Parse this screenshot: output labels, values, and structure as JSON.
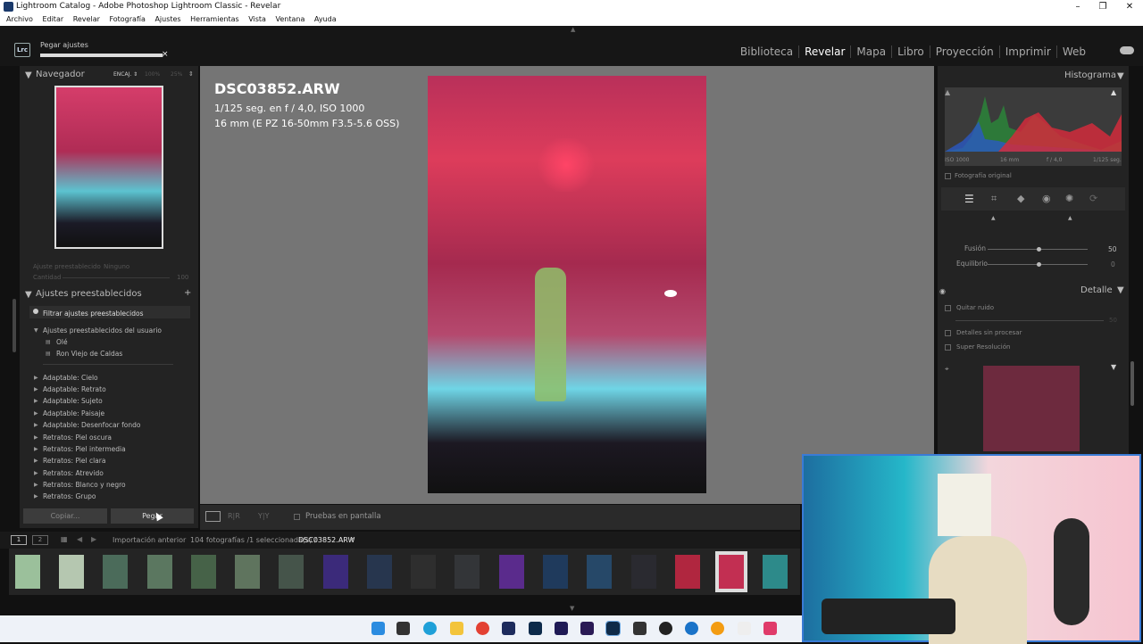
{
  "window": {
    "title": "Lightroom Catalog - Adobe Photoshop Lightroom Classic - Revelar",
    "minimize": "–",
    "maximize": "❐",
    "close": "✕"
  },
  "menu": [
    "Archivo",
    "Editar",
    "Revelar",
    "Fotografía",
    "Ajustes",
    "Herramientas",
    "Vista",
    "Ventana",
    "Ayuda"
  ],
  "topbar": {
    "logo": "Lrc",
    "operation": "Pegar ajustes",
    "progress": 0.99,
    "cancel": "×"
  },
  "modules": [
    "Biblioteca",
    "Revelar",
    "Mapa",
    "Libro",
    "Proyección",
    "Imprimir",
    "Web"
  ],
  "active_module": "Revelar",
  "navigator": {
    "title": "Navegador",
    "zoom_fit": "ENCAJ. ⇕",
    "zoom_100": "100%",
    "zoom_25": "25%"
  },
  "preset_amount": {
    "label": "Ajuste preestablecido",
    "value": "Ninguno",
    "amount_label": "Cantidad",
    "amount_value": "100"
  },
  "presets": {
    "title": "Ajustes preestablecidos",
    "add": "+",
    "filter": "Filtrar ajustes preestablecidos",
    "user_group": "Ajustes preestablecidos del usuario",
    "user_items": [
      "Olé",
      "Ron Viejo de Caldas"
    ],
    "groups": [
      "Adaptable: Cielo",
      "Adaptable: Retrato",
      "Adaptable: Sujeto",
      "Adaptable: Paisaje",
      "Adaptable: Desenfocar fondo",
      "Retratos: Piel oscura",
      "Retratos: Piel intermedia",
      "Retratos: Piel clara",
      "Retratos: Atrevido",
      "Retratos: Blanco y negro",
      "Retratos: Grupo"
    ]
  },
  "buttons": {
    "copy": "Copiar...",
    "paste": "Pegar"
  },
  "photo": {
    "filename": "DSC03852.ARW",
    "exposure": "1/125 seg. en f / 4,0, ISO 1000",
    "lens": "16 mm (E PZ 16-50mm F3.5-5.6 OSS)"
  },
  "toolbar": {
    "softproof": "Pruebas en pantalla",
    "view_rr": "R|R",
    "view_yy": "Y|Y"
  },
  "filmbar": {
    "screen1": "1",
    "screen2": "2",
    "source": "Importación anterior",
    "count": "104 fotografías /1 seleccionada(s) /",
    "current": "DSC03852.ARW"
  },
  "histogram": {
    "title": "Histograma",
    "iso": "ISO 1000",
    "focal": "16 mm",
    "aperture": "f / 4,0",
    "shutter": "1/125 seg.",
    "original": "Fotografía original"
  },
  "sliders": [
    {
      "label": "Fusión",
      "value": "50"
    },
    {
      "label": "Equilibrio",
      "value": "0"
    }
  ],
  "detail": {
    "title": "Detalle",
    "denoise": "Quitar ruido",
    "raw_details": "Detalles sin procesar",
    "super_res": "Super Resolución",
    "denoise_value": "50"
  },
  "colors": {
    "panel": "#232323",
    "center": "#757575",
    "accent_red": "#d83a5c",
    "webcam_border": "#3a7bd5"
  }
}
